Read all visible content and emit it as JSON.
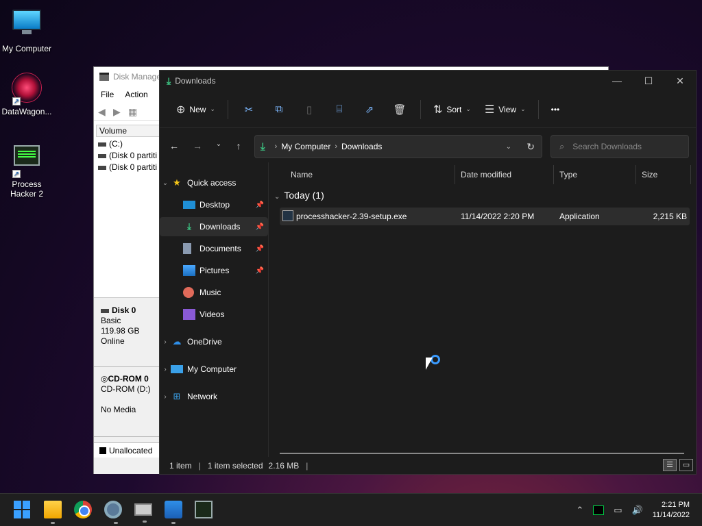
{
  "desktop": {
    "icons": [
      {
        "label": "My Computer",
        "icon": "monitor-icon"
      },
      {
        "label": "DataWagon...",
        "icon": "datawagon-icon"
      },
      {
        "label": "Process Hacker 2",
        "icon": "process-hacker-icon"
      }
    ]
  },
  "disk_management": {
    "title": "Disk Manage",
    "menu": [
      "File",
      "Action"
    ],
    "column_volume": "Volume",
    "volumes": [
      "(C:)",
      "(Disk 0 partiti",
      "(Disk 0 partiti"
    ],
    "disk0": {
      "name": "Disk 0",
      "type": "Basic",
      "size": "119.98 GB",
      "status": "Online"
    },
    "cdrom": {
      "name": "CD-ROM 0",
      "drive": "CD-ROM (D:)",
      "media": "No Media"
    },
    "legend": "Unallocated"
  },
  "explorer": {
    "title": "Downloads",
    "window_buttons": {
      "minimize": "—",
      "maximize": "☐",
      "close": "✕"
    },
    "toolbar": {
      "new_label": "New",
      "sort_label": "Sort",
      "view_label": "View",
      "more": "•••"
    },
    "address": {
      "crumbs": [
        "My Computer",
        "Downloads"
      ]
    },
    "search": {
      "placeholder": "Search Downloads"
    },
    "nav": {
      "quick_access": "Quick access",
      "pinned": [
        {
          "label": "Desktop",
          "icon": "desktop-icon",
          "pinned": true
        },
        {
          "label": "Downloads",
          "icon": "downloads-icon",
          "pinned": true,
          "selected": true
        },
        {
          "label": "Documents",
          "icon": "documents-icon",
          "pinned": true
        },
        {
          "label": "Pictures",
          "icon": "pictures-icon",
          "pinned": true
        },
        {
          "label": "Music",
          "icon": "music-icon",
          "pinned": false
        },
        {
          "label": "Videos",
          "icon": "videos-icon",
          "pinned": false
        }
      ],
      "onedrive": "OneDrive",
      "my_computer": "My Computer",
      "network": "Network"
    },
    "columns": {
      "name": "Name",
      "date": "Date modified",
      "type": "Type",
      "size": "Size"
    },
    "group": "Today (1)",
    "files": [
      {
        "name": "processhacker-2.39-setup.exe",
        "date": "11/14/2022 2:20 PM",
        "type": "Application",
        "size": "2,215 KB"
      }
    ],
    "status": {
      "count": "1 item",
      "selected": "1 item selected",
      "size": "2.16 MB"
    }
  },
  "taskbar": {
    "apps": [
      "start-icon",
      "file-explorer-icon",
      "chrome-icon",
      "settings-icon",
      "disk-management-icon",
      "store-icon",
      "process-hacker-icon"
    ],
    "clock": {
      "time": "2:21 PM",
      "date": "11/14/2022"
    }
  },
  "colors": {
    "accent": "#3a9bff",
    "download_green": "#3cc281",
    "explorer_bg": "#1c1c1c",
    "taskbar_bg": "#1f1f1f"
  }
}
